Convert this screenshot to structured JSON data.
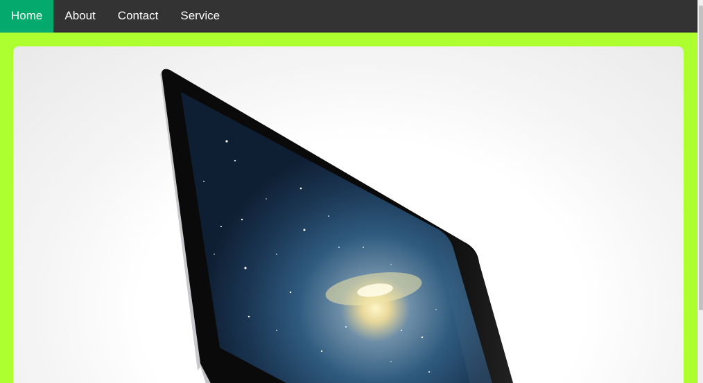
{
  "nav": {
    "items": [
      {
        "label": "Home",
        "active": true
      },
      {
        "label": "About",
        "active": false
      },
      {
        "label": "Contact",
        "active": false
      },
      {
        "label": "Service",
        "active": false
      }
    ]
  },
  "hero_image": {
    "icon": "imac-computer-image"
  },
  "colors": {
    "navbar_background": "#333333",
    "active_nav": "#04aa6d",
    "page_background": "#adff2f",
    "nav_text": "#ffffff"
  }
}
